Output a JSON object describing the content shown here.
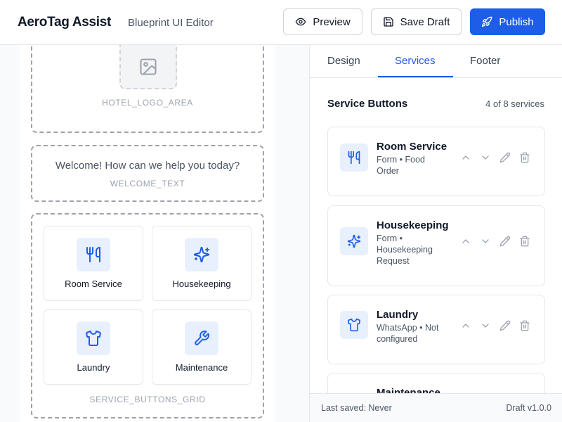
{
  "header": {
    "brand": "AeroTag Assist",
    "subtitle": "Blueprint UI Editor",
    "preview_label": "Preview",
    "save_draft_label": "Save Draft",
    "publish_label": "Publish"
  },
  "canvas": {
    "logo_zone_label": "HOTEL_LOGO_AREA",
    "welcome_text": "Welcome! How can we help you today?",
    "welcome_zone_label": "WELCOME_TEXT",
    "grid_zone_label": "SERVICE_BUTTONS_GRID",
    "tiles": [
      {
        "label": "Room Service",
        "icon": "utensils-icon"
      },
      {
        "label": "Housekeeping",
        "icon": "sparkles-icon"
      },
      {
        "label": "Laundry",
        "icon": "shirt-icon"
      },
      {
        "label": "Maintenance",
        "icon": "wrench-icon"
      }
    ]
  },
  "panel": {
    "tabs": [
      {
        "label": "Design",
        "active": false
      },
      {
        "label": "Services",
        "active": true
      },
      {
        "label": "Footer",
        "active": false
      }
    ],
    "section_title": "Service Buttons",
    "section_count": "4 of 8 services",
    "cards": [
      {
        "title": "Room Service",
        "subtitle": "Form • Food Order",
        "icon": "utensils-icon"
      },
      {
        "title": "Housekeeping",
        "subtitle": "Form • Housekeeping Request",
        "icon": "sparkles-icon"
      },
      {
        "title": "Laundry",
        "subtitle": "WhatsApp • Not configured",
        "icon": "shirt-icon"
      },
      {
        "title": "Maintenance",
        "subtitle": "",
        "icon": "wrench-icon"
      }
    ],
    "last_saved": "Last saved: Never",
    "version": "Draft v1.0.0"
  },
  "colors": {
    "accent": "#1d5de8",
    "icon_bg": "#e8f0fe",
    "dashed_border": "#a1a1aa"
  }
}
